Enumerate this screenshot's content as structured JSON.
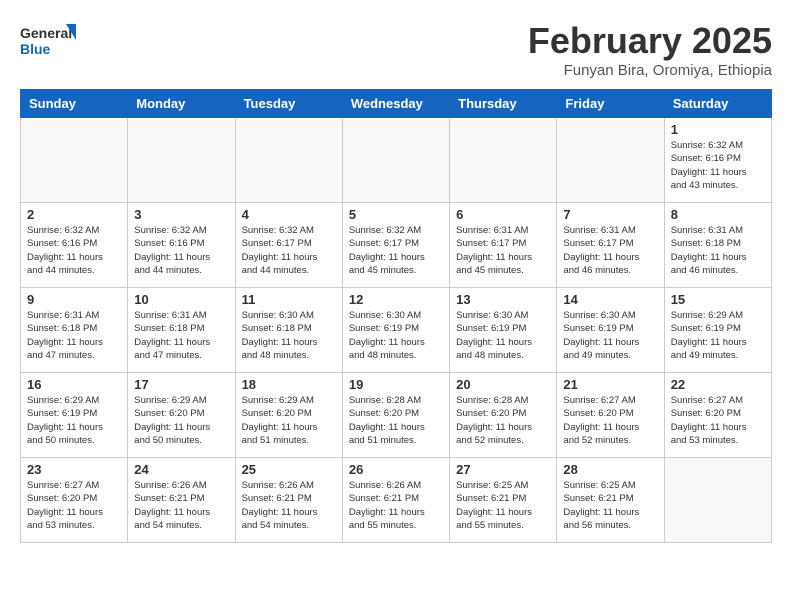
{
  "header": {
    "logo_general": "General",
    "logo_blue": "Blue",
    "month_year": "February 2025",
    "location": "Funyan Bira, Oromiya, Ethiopia"
  },
  "weekdays": [
    "Sunday",
    "Monday",
    "Tuesday",
    "Wednesday",
    "Thursday",
    "Friday",
    "Saturday"
  ],
  "weeks": [
    [
      {
        "day": "",
        "info": ""
      },
      {
        "day": "",
        "info": ""
      },
      {
        "day": "",
        "info": ""
      },
      {
        "day": "",
        "info": ""
      },
      {
        "day": "",
        "info": ""
      },
      {
        "day": "",
        "info": ""
      },
      {
        "day": "1",
        "info": "Sunrise: 6:32 AM\nSunset: 6:16 PM\nDaylight: 11 hours and 43 minutes."
      }
    ],
    [
      {
        "day": "2",
        "info": "Sunrise: 6:32 AM\nSunset: 6:16 PM\nDaylight: 11 hours and 44 minutes."
      },
      {
        "day": "3",
        "info": "Sunrise: 6:32 AM\nSunset: 6:16 PM\nDaylight: 11 hours and 44 minutes."
      },
      {
        "day": "4",
        "info": "Sunrise: 6:32 AM\nSunset: 6:17 PM\nDaylight: 11 hours and 44 minutes."
      },
      {
        "day": "5",
        "info": "Sunrise: 6:32 AM\nSunset: 6:17 PM\nDaylight: 11 hours and 45 minutes."
      },
      {
        "day": "6",
        "info": "Sunrise: 6:31 AM\nSunset: 6:17 PM\nDaylight: 11 hours and 45 minutes."
      },
      {
        "day": "7",
        "info": "Sunrise: 6:31 AM\nSunset: 6:17 PM\nDaylight: 11 hours and 46 minutes."
      },
      {
        "day": "8",
        "info": "Sunrise: 6:31 AM\nSunset: 6:18 PM\nDaylight: 11 hours and 46 minutes."
      }
    ],
    [
      {
        "day": "9",
        "info": "Sunrise: 6:31 AM\nSunset: 6:18 PM\nDaylight: 11 hours and 47 minutes."
      },
      {
        "day": "10",
        "info": "Sunrise: 6:31 AM\nSunset: 6:18 PM\nDaylight: 11 hours and 47 minutes."
      },
      {
        "day": "11",
        "info": "Sunrise: 6:30 AM\nSunset: 6:18 PM\nDaylight: 11 hours and 48 minutes."
      },
      {
        "day": "12",
        "info": "Sunrise: 6:30 AM\nSunset: 6:19 PM\nDaylight: 11 hours and 48 minutes."
      },
      {
        "day": "13",
        "info": "Sunrise: 6:30 AM\nSunset: 6:19 PM\nDaylight: 11 hours and 48 minutes."
      },
      {
        "day": "14",
        "info": "Sunrise: 6:30 AM\nSunset: 6:19 PM\nDaylight: 11 hours and 49 minutes."
      },
      {
        "day": "15",
        "info": "Sunrise: 6:29 AM\nSunset: 6:19 PM\nDaylight: 11 hours and 49 minutes."
      }
    ],
    [
      {
        "day": "16",
        "info": "Sunrise: 6:29 AM\nSunset: 6:19 PM\nDaylight: 11 hours and 50 minutes."
      },
      {
        "day": "17",
        "info": "Sunrise: 6:29 AM\nSunset: 6:20 PM\nDaylight: 11 hours and 50 minutes."
      },
      {
        "day": "18",
        "info": "Sunrise: 6:29 AM\nSunset: 6:20 PM\nDaylight: 11 hours and 51 minutes."
      },
      {
        "day": "19",
        "info": "Sunrise: 6:28 AM\nSunset: 6:20 PM\nDaylight: 11 hours and 51 minutes."
      },
      {
        "day": "20",
        "info": "Sunrise: 6:28 AM\nSunset: 6:20 PM\nDaylight: 11 hours and 52 minutes."
      },
      {
        "day": "21",
        "info": "Sunrise: 6:27 AM\nSunset: 6:20 PM\nDaylight: 11 hours and 52 minutes."
      },
      {
        "day": "22",
        "info": "Sunrise: 6:27 AM\nSunset: 6:20 PM\nDaylight: 11 hours and 53 minutes."
      }
    ],
    [
      {
        "day": "23",
        "info": "Sunrise: 6:27 AM\nSunset: 6:20 PM\nDaylight: 11 hours and 53 minutes."
      },
      {
        "day": "24",
        "info": "Sunrise: 6:26 AM\nSunset: 6:21 PM\nDaylight: 11 hours and 54 minutes."
      },
      {
        "day": "25",
        "info": "Sunrise: 6:26 AM\nSunset: 6:21 PM\nDaylight: 11 hours and 54 minutes."
      },
      {
        "day": "26",
        "info": "Sunrise: 6:26 AM\nSunset: 6:21 PM\nDaylight: 11 hours and 55 minutes."
      },
      {
        "day": "27",
        "info": "Sunrise: 6:25 AM\nSunset: 6:21 PM\nDaylight: 11 hours and 55 minutes."
      },
      {
        "day": "28",
        "info": "Sunrise: 6:25 AM\nSunset: 6:21 PM\nDaylight: 11 hours and 56 minutes."
      },
      {
        "day": "",
        "info": ""
      }
    ]
  ]
}
